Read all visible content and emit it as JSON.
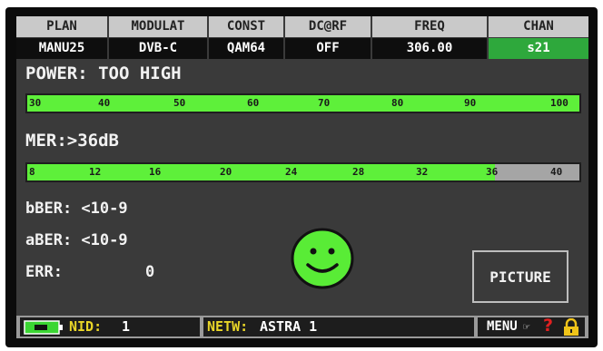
{
  "header": {
    "columns": [
      {
        "label": "PLAN",
        "value": "MANU25"
      },
      {
        "label": "MODULAT",
        "value": "DVB-C"
      },
      {
        "label": "CONST",
        "value": "QAM64"
      },
      {
        "label": "DC@RF",
        "value": "OFF"
      },
      {
        "label": "FREQ",
        "value": "306.00"
      },
      {
        "label": "CHAN",
        "value": "s21",
        "active": true
      }
    ]
  },
  "power": {
    "label": "POWER: TOO HIGH",
    "scale_ticks": [
      "30",
      "40",
      "50",
      "60",
      "70",
      "80",
      "90",
      "100"
    ],
    "level_fraction": 1.0
  },
  "mer": {
    "label": "MER:>36dB",
    "scale_ticks": [
      "8",
      "12",
      "16",
      "20",
      "24",
      "28",
      "32",
      "36",
      "40"
    ],
    "level_value": 36
  },
  "measurements": {
    "bber": "bBER: <10-9",
    "aber": "aBER: <10-9",
    "err_label": "ERR:",
    "err_value": "0"
  },
  "status_icon": "smiley-face-icon",
  "picture_button": {
    "label": "PICTURE"
  },
  "status_bar": {
    "battery_icon": "battery-icon",
    "nid_label": "NID:",
    "nid_value": "1",
    "netw_label": "NETW:",
    "netw_value": "ASTRA 1",
    "menu_label": "MENU",
    "menu_icon": "menu-hand-icon",
    "help_icon": "question-mark-icon",
    "lock_icon": "padlock-icon"
  },
  "colors": {
    "good": "#5ef03a",
    "active_channel": "#2ea83c",
    "status_yellow": "#e9d628",
    "help_red": "#e02020",
    "lock_yellow": "#f0c419"
  }
}
